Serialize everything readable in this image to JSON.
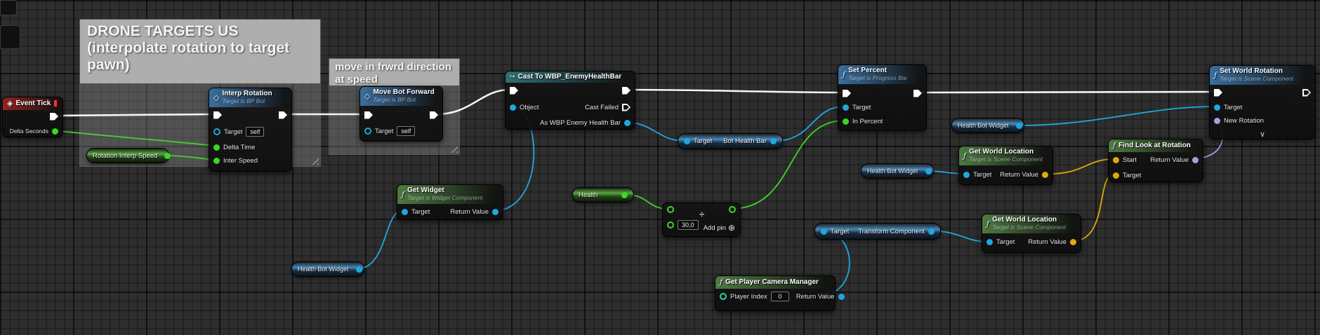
{
  "colors": {
    "wire-exec": "#f5f5f5",
    "wire-float": "#3fd42a",
    "wire-object": "#1fa8e0",
    "wire-vector": "#dcab0c",
    "wire-rotator": "#a79fe2",
    "pin-int": "#2bd29c",
    "header-event": "#942222",
    "header-function-blue": "#3a6f9e",
    "header-function-green": "#4e7a41",
    "header-cast": "#2f6f74"
  },
  "comments": {
    "drone": {
      "title": "DRONE TARGETS US (interpolate rotation to target pawn)"
    },
    "move": {
      "title": "move in frwrd direction at speed"
    }
  },
  "nodes": {
    "event_tick": {
      "title": "Event Tick",
      "delta_seconds": "Delta Seconds"
    },
    "interp_rotation": {
      "title": "Interp Rotation",
      "subtitle": "Target is BP Bot",
      "target": "Target",
      "target_value": "self",
      "delta_time": "Delta Time",
      "inter_speed": "Inter Speed"
    },
    "move_bot_forward": {
      "title": "Move Bot Forward",
      "subtitle": "Target is BP Bot",
      "target": "Target",
      "target_value": "self"
    },
    "cast": {
      "title": "Cast To WBP_EnemyHealthBar",
      "object": "Object",
      "cast_failed": "Cast Failed",
      "as_output": "As WBP Enemy Health Bar"
    },
    "get_widget": {
      "title": "Get Widget",
      "subtitle": "Target is Widget Component",
      "target": "Target",
      "return_value": "Return Value"
    },
    "set_percent": {
      "title": "Set Percent",
      "subtitle": "Target is Progress Bar",
      "target": "Target",
      "in_percent": "In Percent"
    },
    "divide": {
      "operator": "÷",
      "value": "30,0",
      "add_pin": "Add pin",
      "add_pin_icon": "⊕"
    },
    "get_player_camera_manager": {
      "title": "Get Player Camera Manager",
      "player_index": "Player Index",
      "player_index_value": "0",
      "return_value": "Return Value"
    },
    "get_world_location_top": {
      "title": "Get World Location",
      "subtitle": "Target is Scene Component",
      "target": "Target",
      "return_value": "Return Value"
    },
    "get_world_location_bottom": {
      "title": "Get World Location",
      "subtitle": "Target is Scene Component",
      "target": "Target",
      "return_value": "Return Value"
    },
    "find_look_at_rotation": {
      "title": "Find Look at Rotation",
      "start": "Start",
      "target": "Target",
      "return_value": "Return Value"
    },
    "set_world_rotation": {
      "title": "Set World Rotation",
      "subtitle": "Target is Scene Component",
      "target": "Target",
      "new_rotation": "New Rotation",
      "collapse_chevron": "∨"
    }
  },
  "variables": {
    "rotation_interp_speed": "Rotation Interp Speed",
    "health": "Health",
    "health_bot_widget": "Health Bot Widget",
    "bot_health_bar": {
      "target": "Target",
      "output": "Bot Health Bar"
    },
    "transform_component": {
      "target": "Target",
      "output": "Transform Component"
    }
  }
}
